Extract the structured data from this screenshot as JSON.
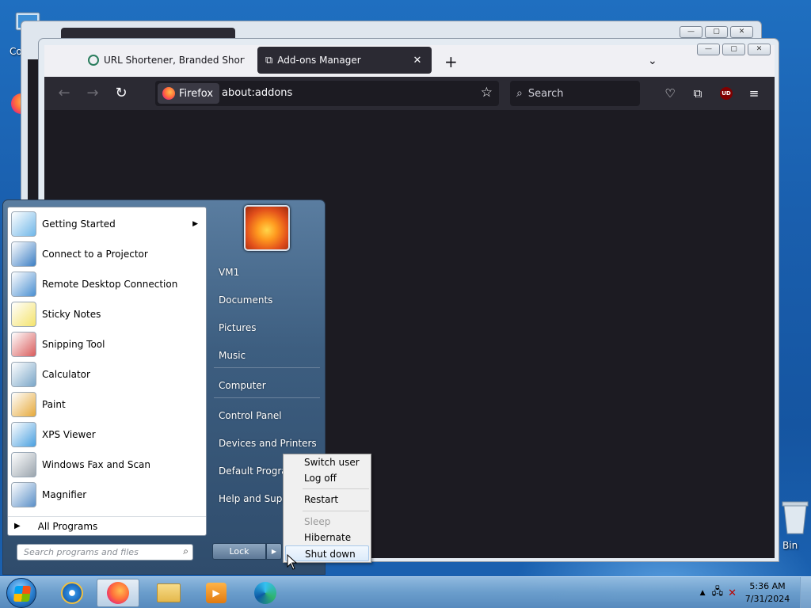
{
  "desktop": {
    "icons": [
      {
        "label": "Co",
        "name": "computer"
      },
      {
        "label": "Bin",
        "name": "recycle-bin"
      }
    ]
  },
  "back_window": {
    "caption_buttons": [
      "—",
      "▢",
      "✕"
    ]
  },
  "firefox": {
    "caption_buttons": [
      "—",
      "▢",
      "✕"
    ],
    "tabs": [
      {
        "title": "URL Shortener, Branded Short Li",
        "active": false
      },
      {
        "title": "Add-ons Manager",
        "active": true
      }
    ],
    "new_tab": "+",
    "tab_list": "⌄",
    "identity_label": "Firefox",
    "url": "about:addons",
    "search_placeholder": "Search",
    "ublock_label": "UD"
  },
  "start_menu": {
    "programs": [
      {
        "label": "Getting Started",
        "icon": "getting-started-icon",
        "has_submenu": true,
        "color": "#6fb6e8"
      },
      {
        "label": "Connect to a Projector",
        "icon": "projector-icon",
        "has_submenu": false,
        "color": "#3c7fc4"
      },
      {
        "label": "Remote Desktop Connection",
        "icon": "remote-desktop-icon",
        "has_submenu": false,
        "color": "#4a8fd1"
      },
      {
        "label": "Sticky Notes",
        "icon": "sticky-notes-icon",
        "has_submenu": false,
        "color": "#f4e36b"
      },
      {
        "label": "Snipping Tool",
        "icon": "snipping-tool-icon",
        "has_submenu": false,
        "color": "#d95c5c"
      },
      {
        "label": "Calculator",
        "icon": "calculator-icon",
        "has_submenu": false,
        "color": "#7aa6c8"
      },
      {
        "label": "Paint",
        "icon": "paint-icon",
        "has_submenu": false,
        "color": "#e6a93a"
      },
      {
        "label": "XPS Viewer",
        "icon": "xps-viewer-icon",
        "has_submenu": false,
        "color": "#4aa0e0"
      },
      {
        "label": "Windows Fax and Scan",
        "icon": "fax-scan-icon",
        "has_submenu": false,
        "color": "#9aa4ad"
      },
      {
        "label": "Magnifier",
        "icon": "magnifier-icon",
        "has_submenu": false,
        "color": "#5a8fc7"
      }
    ],
    "all_programs": "All Programs",
    "search_placeholder": "Search programs and files",
    "places": [
      "VM1",
      "Documents",
      "Pictures",
      "Music",
      "Computer",
      "Control Panel",
      "Devices and Printers",
      "Default Programs",
      "Help and Support"
    ],
    "lock_label": "Lock",
    "power_arrow": "▶"
  },
  "power_menu": {
    "items": [
      {
        "label": "Switch user",
        "disabled": false
      },
      {
        "label": "Log off",
        "disabled": false
      },
      {
        "label": "Restart",
        "disabled": false
      },
      {
        "label": "Sleep",
        "disabled": true
      },
      {
        "label": "Hibernate",
        "disabled": false
      },
      {
        "label": "Shut down",
        "disabled": false
      }
    ]
  },
  "taskbar": {
    "pinned": [
      "internet-explorer",
      "firefox",
      "file-explorer",
      "media-player",
      "edge"
    ],
    "clock_time": "5:36 AM",
    "clock_date": "7/31/2024"
  }
}
